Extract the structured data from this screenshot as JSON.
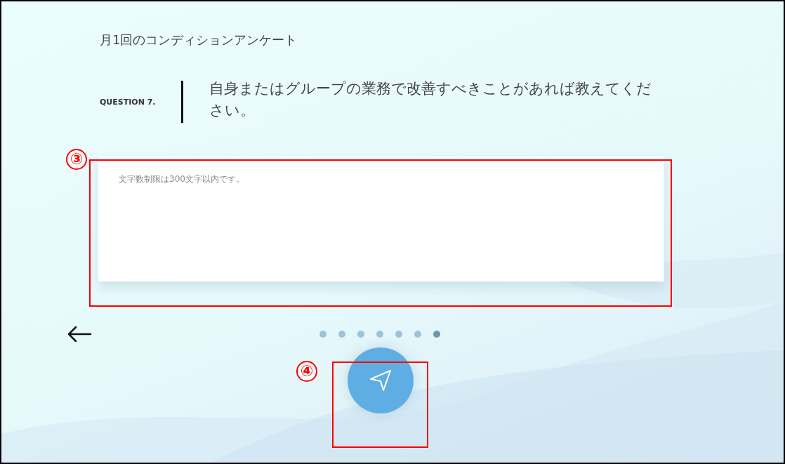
{
  "survey_title": "月1回のコンディションアンケート",
  "question": {
    "number_label": "QUESTION 7.",
    "text": "自身またはグループの業務で改善すべきことがあれば教えてください。"
  },
  "answer": {
    "placeholder": "文字数制限は300文字以内です。"
  },
  "pagination": [
    {
      "selected": false
    },
    {
      "selected": false
    },
    {
      "selected": false
    },
    {
      "selected": false
    },
    {
      "selected": false
    },
    {
      "selected": false
    },
    {
      "selected": true
    }
  ],
  "annotations": [
    {
      "label": "③"
    },
    {
      "label": "④"
    }
  ]
}
